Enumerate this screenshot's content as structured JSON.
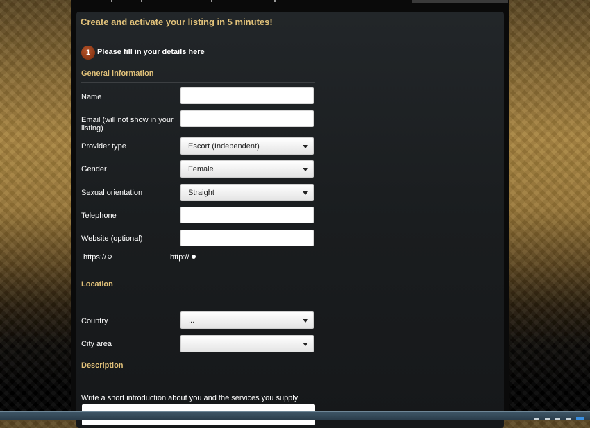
{
  "page": {
    "headline": "Create and activate your listing in 5 minutes!",
    "step_number": "1",
    "step_text": "Please fill in your details here"
  },
  "general": {
    "heading": "General information",
    "name_label": "Name",
    "email_label_line1": "Email (will not show in your",
    "email_label_line2": "listing)",
    "provider_label": "Provider type",
    "provider_value": "Escort (Independent)",
    "gender_label": "Gender",
    "gender_value": "Female",
    "orientation_label": "Sexual orientation",
    "orientation_value": "Straight",
    "telephone_label": "Telephone",
    "website_label": "Website (optional)",
    "protocol_options": [
      {
        "label": "https://",
        "selected": false
      },
      {
        "label": "http://",
        "selected": true
      }
    ]
  },
  "location": {
    "heading": "Location",
    "country_label": "Country",
    "country_value": "...",
    "city_label": "City area",
    "city_value": ""
  },
  "description": {
    "heading": "Description",
    "intro_label": "Write a short introduction about you and the services you supply"
  },
  "colors": {
    "accent": "#e2c27a",
    "badge": "#9a3a14",
    "panel": "#1c1f21"
  }
}
